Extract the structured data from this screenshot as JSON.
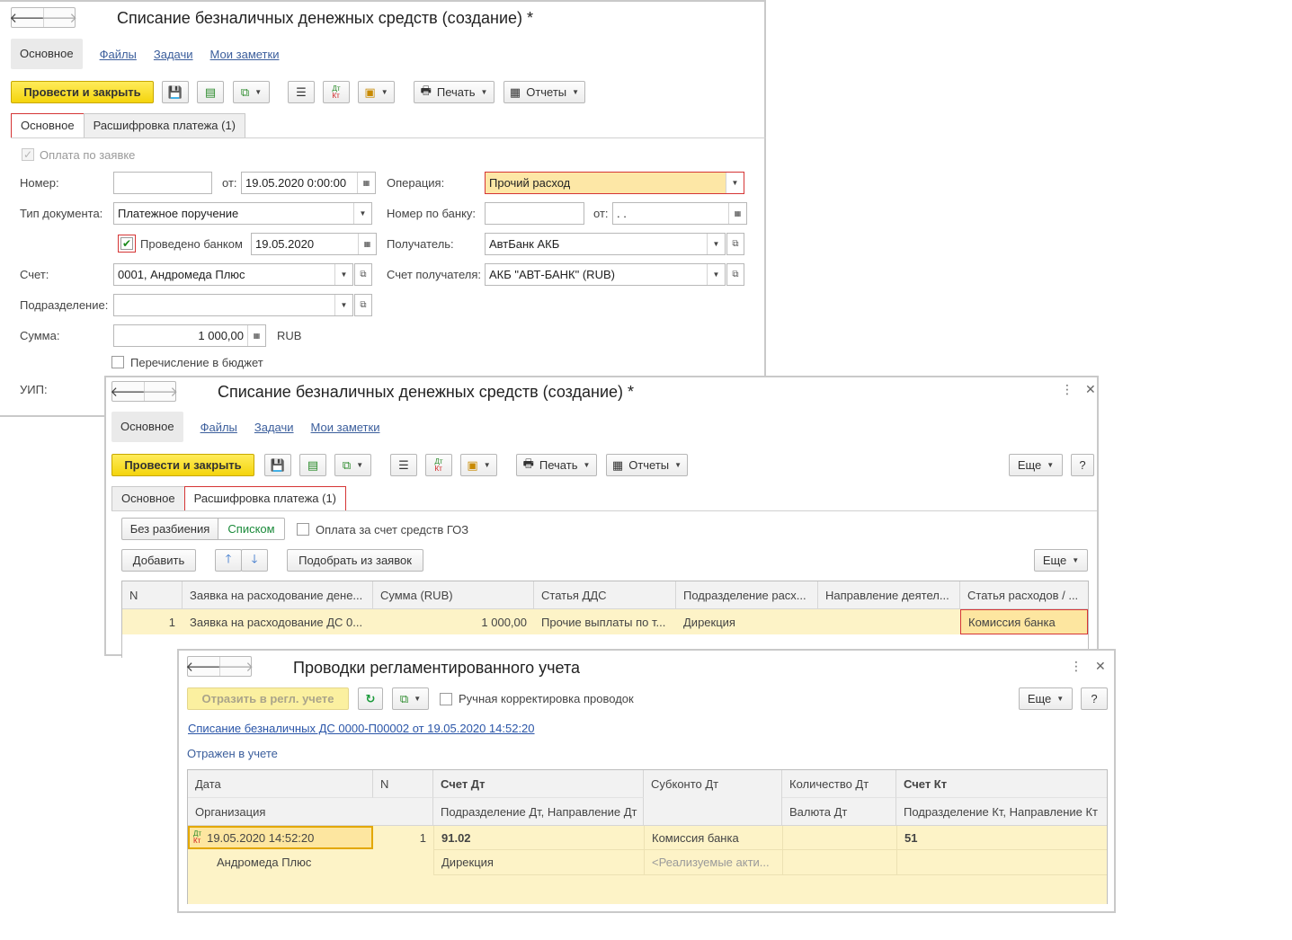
{
  "window1": {
    "title": "Списание безналичных денежных средств (создание) *",
    "nav": {
      "main": "Основное",
      "links": [
        "Файлы",
        "Задачи",
        "Мои заметки"
      ]
    },
    "toolbar": {
      "post_close": "Провести и закрыть",
      "print": "Печать",
      "reports": "Отчеты"
    },
    "tabs": [
      "Основное",
      "Расшифровка платежа (1)"
    ],
    "form": {
      "pay_by_request": "Оплата по заявке",
      "number_label": "Номер:",
      "number_value": "",
      "from_label": "от:",
      "date_value": "19.05.2020  0:00:00",
      "operation_label": "Операция:",
      "operation_value": "Прочий расход",
      "doc_type_label": "Тип документа:",
      "doc_type_value": "Платежное поручение",
      "bank_number_label": "Номер по банку:",
      "bank_number_value": "",
      "bank_date_from_label": "от:",
      "bank_date_value": " .  .",
      "posted_by_bank_label": "Проведено банком",
      "posted_by_bank_date": "19.05.2020",
      "recipient_label": "Получатель:",
      "recipient_value": "АвтБанк АКБ",
      "account_label": "Счет:",
      "account_value": "0001, Андромеда Плюс",
      "recipient_account_label": "Счет получателя:",
      "recipient_account_value": "АКБ \"АВТ-БАНК\" (RUB)",
      "department_label": "Подразделение:",
      "department_value": "",
      "amount_label": "Сумма:",
      "amount_value": "1 000,00",
      "currency": "RUB",
      "budget_transfer_label": "Перечисление в бюджет",
      "uip_label": "УИП:"
    }
  },
  "window2": {
    "title": "Списание безналичных денежных средств (создание) *",
    "nav": {
      "main": "Основное",
      "links": [
        "Файлы",
        "Задачи",
        "Мои заметки"
      ]
    },
    "toolbar": {
      "post_close": "Провести и закрыть",
      "print": "Печать",
      "reports": "Отчеты",
      "more": "Еще",
      "help": "?"
    },
    "tabs": [
      "Основное",
      "Расшифровка платежа (1)"
    ],
    "split_modes": [
      "Без разбиения",
      "Списком"
    ],
    "goz_label": "Оплата за счет средств ГОЗ",
    "add_button": "Добавить",
    "pick_button": "Подобрать из заявок",
    "more": "Еще",
    "table": {
      "headers": [
        "N",
        "Заявка на расходование дене...",
        "Сумма (RUB)",
        "Статья ДДС",
        "Подразделение расх...",
        "Направление деятел...",
        "Статья расходов / ..."
      ],
      "rows": [
        [
          "1",
          "Заявка на расходование ДС 0...",
          "1 000,00",
          "Прочие выплаты по т...",
          "Дирекция",
          "",
          "Комиссия банка"
        ]
      ]
    }
  },
  "window3": {
    "title": "Проводки регламентированного учета",
    "toolbar": {
      "reflect": "Отразить в регл. учете",
      "manual_label": "Ручная корректировка проводок",
      "more": "Еще",
      "help": "?"
    },
    "doc_link": "Списание безналичных ДС 0000-П00002 от 19.05.2020 14:52:20",
    "status": "Отражен в учете",
    "table": {
      "headers_top": [
        "Дата",
        "N",
        "Счет Дт",
        "Субконто Дт",
        "Количество Дт",
        "Счет Кт"
      ],
      "headers_bottom": [
        "Организация",
        "Подразделение Дт, Направление Дт",
        "Валюта Дт",
        "Подразделение Кт, Направление Кт"
      ],
      "row": {
        "date": "19.05.2020 14:52:20",
        "n": "1",
        "account_dt": "91.02",
        "subconto_dt": "Комиссия банка",
        "quantity_dt": "",
        "account_kt": "51",
        "organization": "Андромеда Плюс",
        "department_dt": "Дирекция",
        "subconto_dt2": "<Реализуемые акти...",
        "currency_dt": "",
        "department_kt": ""
      }
    }
  }
}
